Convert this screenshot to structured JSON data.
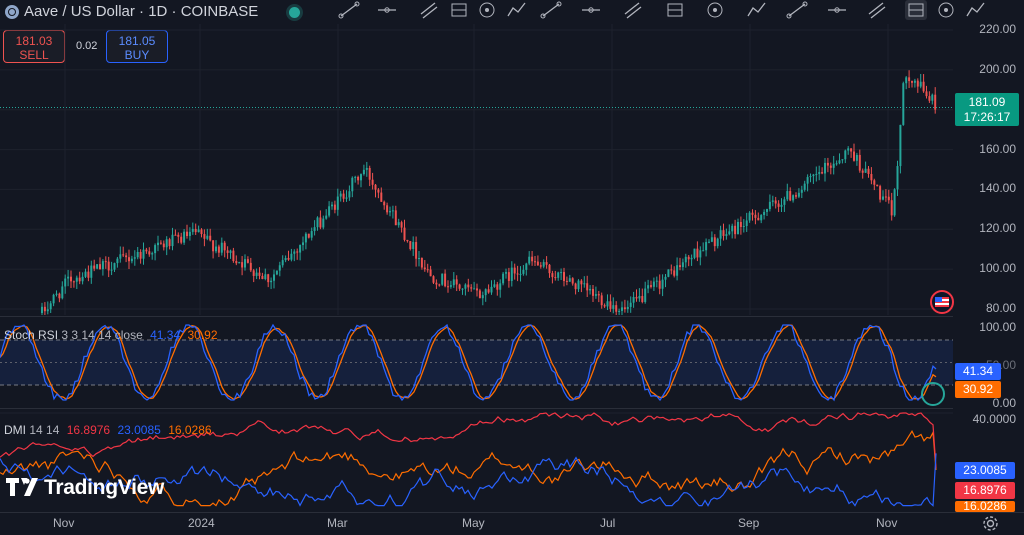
{
  "header": {
    "symbol_title": "Aave / US Dollar · 1D · COINBASE",
    "toolbar_icons": [
      "trend-line-icon",
      "horizontal-line-icon",
      "channel-icon",
      "pitchfork-icon",
      "fib-icon",
      "gann-icon",
      "pattern-icon",
      "elliott-icon",
      "cycle-icon",
      "projection-icon",
      "ruler-icon",
      "date-range-icon",
      "price-range-icon",
      "brush-icon",
      "anchored-vwap-icon",
      "text-icon",
      "shape-icon",
      "path-icon"
    ]
  },
  "trade": {
    "sell_price": "181.03",
    "sell_label": "SELL",
    "spread": "0.02",
    "buy_price": "181.05",
    "buy_label": "BUY"
  },
  "price_axis": {
    "labels": [
      "220.00",
      "200.00",
      "180.00",
      "160.00",
      "140.00",
      "120.00",
      "100.00",
      "80.00"
    ],
    "range": [
      77,
      223
    ],
    "last_price": "181.09",
    "countdown": "17:26:17"
  },
  "stoch_rsi": {
    "title": "Stoch RSI",
    "params": "3 3 14 14 close",
    "k_value": "41.34",
    "d_value": "30.92",
    "axis_labels": [
      "100.00",
      "50.00",
      "0.00"
    ],
    "bands": [
      20,
      80
    ]
  },
  "dmi": {
    "title": "DMI",
    "params": "14 14",
    "adx_value": "16.8976",
    "plus_di_value": "23.0085",
    "minus_di_value": "16.0286",
    "axis_labels": [
      "40.0000"
    ]
  },
  "time_axis": {
    "labels": [
      "Nov",
      "2024",
      "Mar",
      "May",
      "Jul",
      "Sep",
      "Nov"
    ]
  },
  "branding": {
    "name": "TradingView"
  },
  "colors": {
    "up": "#26a69a",
    "down": "#ef5350",
    "stoch_k": "#2962ff",
    "stoch_d": "#ff6d00",
    "dmi_plus": "#2962ff",
    "dmi_minus": "#ff6d00",
    "dmi_adx": "#f23645"
  },
  "chart_data": {
    "type": "candlestick",
    "title": "Aave / US Dollar · 1D · COINBASE",
    "ylim": [
      77,
      223
    ],
    "x_ticks": [
      "Nov",
      "2024",
      "Mar",
      "May",
      "Jul",
      "Sep",
      "Nov"
    ],
    "close_path": [
      {
        "t": "Oct 2023 start",
        "v": 78
      },
      {
        "t": "Nov 2023",
        "v": 95
      },
      {
        "t": "Dec 2023",
        "v": 106
      },
      {
        "t": "Jan 2024",
        "v": 118
      },
      {
        "t": "Feb 2024",
        "v": 95
      },
      {
        "t": "Mar 2024",
        "v": 150
      },
      {
        "t": "Apr 2024",
        "v": 97
      },
      {
        "t": "May 2024",
        "v": 87
      },
      {
        "t": "Jun 2024",
        "v": 104
      },
      {
        "t": "Jul 2024",
        "v": 79
      },
      {
        "t": "Aug 2024",
        "v": 110
      },
      {
        "t": "Sep 2024",
        "v": 140
      },
      {
        "t": "Oct 2024",
        "v": 160
      },
      {
        "t": "Nov 2024 low",
        "v": 128
      },
      {
        "t": "Nov 2024 high",
        "v": 200
      },
      {
        "t": "last",
        "v": 181.09
      }
    ]
  }
}
